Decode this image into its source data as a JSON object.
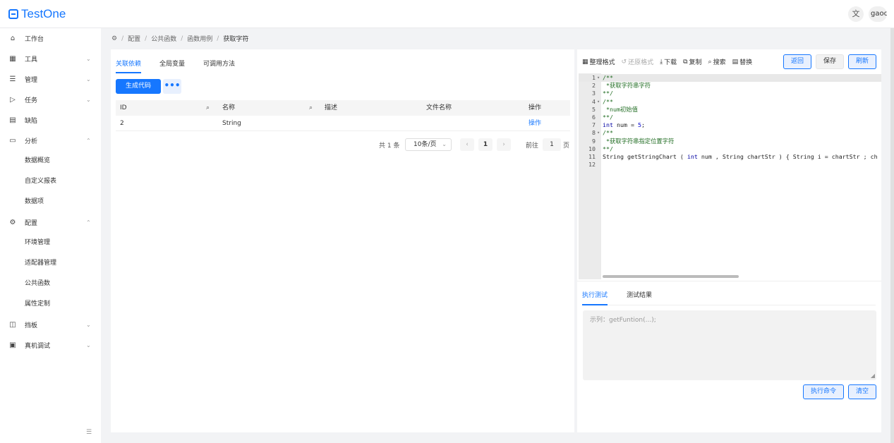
{
  "header": {
    "logo_text": "TestOne",
    "translate_icon": "文",
    "user_label": "gaoc"
  },
  "sidebar": {
    "items": [
      {
        "label": "工作台",
        "icon": "home-icon",
        "glyph": "⌂",
        "chevron": ""
      },
      {
        "label": "工具",
        "icon": "grid-icon",
        "glyph": "▦",
        "chevron": "⌄"
      },
      {
        "label": "管理",
        "icon": "list-icon",
        "glyph": "☰",
        "chevron": "⌄"
      },
      {
        "label": "任务",
        "icon": "send-icon",
        "glyph": "▷",
        "chevron": "⌄"
      },
      {
        "label": "缺陷",
        "icon": "file-icon",
        "glyph": "▤",
        "chevron": ""
      },
      {
        "label": "分析",
        "icon": "calendar-icon",
        "glyph": "▭",
        "chevron": "⌃"
      },
      {
        "label": "配置",
        "icon": "gear-icon",
        "glyph": "⚙",
        "chevron": "⌃"
      },
      {
        "label": "挡板",
        "icon": "panel-icon",
        "glyph": "◫",
        "chevron": "⌄"
      },
      {
        "label": "真机调试",
        "icon": "device-icon",
        "glyph": "▣",
        "chevron": "⌄"
      }
    ],
    "analysis_sub": [
      "数据概览",
      "自定义报表",
      "数据项"
    ],
    "config_sub": [
      "环境管理",
      "适配器管理",
      "公共函数",
      "属性定制"
    ],
    "collapse_icon": "☰"
  },
  "breadcrumb": {
    "home_icon": "⚙",
    "items": [
      "配置",
      "公共函数",
      "函数用例"
    ],
    "current": "获取字符",
    "sep": "/"
  },
  "left": {
    "tabs": [
      "关联依赖",
      "全局变量",
      "可调用方法"
    ],
    "generate_button": "生成代码",
    "more_button": "•••",
    "table": {
      "headers": [
        "ID",
        "名称",
        "描述",
        "文件名称",
        "操作"
      ],
      "rows": [
        {
          "id": "2",
          "name": "String",
          "desc": "",
          "file": "",
          "op": "操作"
        }
      ]
    },
    "pagination": {
      "total": "共 1 条",
      "page_size": "10条/页",
      "prev": "‹",
      "current_page": "1",
      "next": "›",
      "goto_label": "前往",
      "goto_value": "1",
      "page_unit": "页"
    }
  },
  "right": {
    "toolbar": {
      "format": "整理格式",
      "restore": "还原格式",
      "download": "下载",
      "copy": "复制",
      "search": "搜索",
      "replace": "替换",
      "back": "返回",
      "save": "保存",
      "refresh": "刷新"
    },
    "code_lines": [
      {
        "n": "1",
        "fold": "▾",
        "html": "<span class='cm'>/**</span>"
      },
      {
        "n": "2",
        "fold": "",
        "html": "<span class='cm'> *获取字符串字符</span>"
      },
      {
        "n": "3",
        "fold": "",
        "html": "<span class='cm'>**/</span>"
      },
      {
        "n": "4",
        "fold": "▾",
        "html": "<span class='cm'>/**</span>"
      },
      {
        "n": "5",
        "fold": "",
        "html": "<span class='cm'> *num初始值</span>"
      },
      {
        "n": "6",
        "fold": "",
        "html": "<span class='cm'>**/</span>"
      },
      {
        "n": "7",
        "fold": "",
        "html": "<span class='kw'>int</span> num = <span class='num'>5</span>;"
      },
      {
        "n": "8",
        "fold": "▾",
        "html": "<span class='cm'>/**</span>"
      },
      {
        "n": "9",
        "fold": "",
        "html": "<span class='cm'> *获取字符串指定位置字符</span>"
      },
      {
        "n": "10",
        "fold": "",
        "html": "<span class='cm'>**/</span>"
      },
      {
        "n": "11",
        "fold": "",
        "html": "String getStringChart ( <span class='kw'>int</span> num , String chartStr ) { String i = chartStr ; ch"
      },
      {
        "n": "12",
        "fold": "",
        "html": ""
      }
    ],
    "bottom_tabs": [
      "执行测试",
      "测试结果"
    ],
    "command_placeholder": "示列：getFuntion(...);",
    "exec_button": "执行命令",
    "clear_button": "清空"
  }
}
